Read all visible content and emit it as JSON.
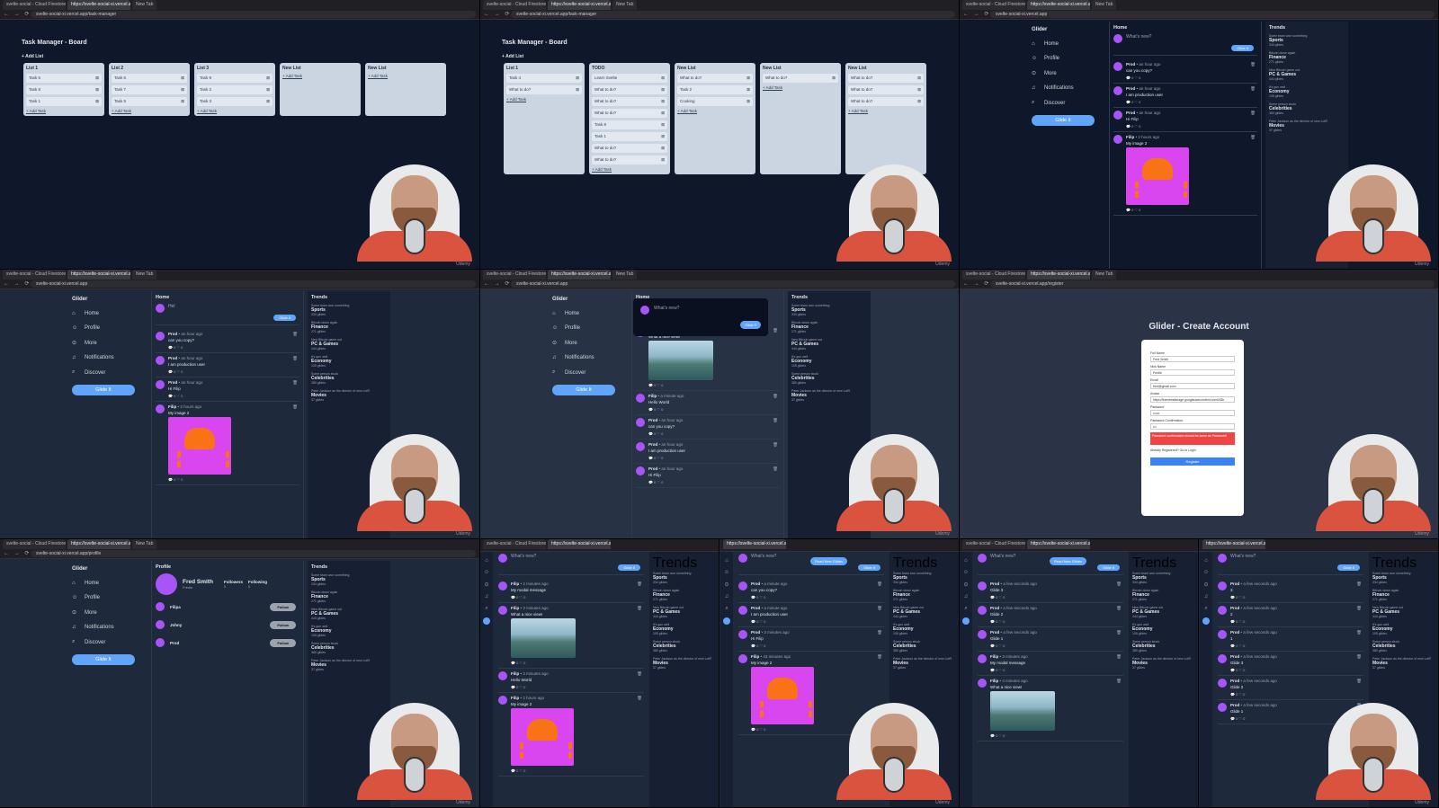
{
  "browser": {
    "tabs": [
      "svelte-social - Cloud Firestore",
      "https://svelte-social-xi.vercel.app",
      "New Tab"
    ],
    "urls": [
      "svelte-social-xi.vercel.app",
      "svelte-social-xi.vercel.app/task-manager",
      "svelte-social-xi.vercel.app/register",
      "svelte-social-xi.vercel.app/profile"
    ],
    "nav_dots": "← → ⟳"
  },
  "webcam_label": "Udemy",
  "board1": {
    "title": "Task Manager - Board",
    "add_list": "+ Add List",
    "lists": [
      {
        "title": "List 1",
        "tasks": [
          "Task 6",
          "Task 8",
          "Task 1"
        ]
      },
      {
        "title": "List 2",
        "tasks": [
          "Task 6",
          "Task 7",
          "Task 5"
        ]
      },
      {
        "title": "List 3",
        "tasks": [
          "Task 9",
          "Task 2",
          "Task 3"
        ]
      },
      {
        "title": "New List",
        "tasks": []
      },
      {
        "title": "New List",
        "tasks": []
      }
    ],
    "add_task": "+ Add Task"
  },
  "board2": {
    "title": "Task Manager - Board",
    "add_list": "+ Add List",
    "lists": [
      {
        "title": "List 1",
        "tasks": [
          "Task 4",
          "What to do?"
        ]
      },
      {
        "title": "TODO",
        "tasks": [
          "Learn Svelte",
          "What to do?",
          "What to do?",
          "What to do?",
          "Task 8",
          "Task 1",
          "What to do?",
          "What to do?"
        ]
      },
      {
        "title": "New List",
        "tasks": [
          "What to do?",
          "Task 2",
          "Cooking"
        ]
      },
      {
        "title": "New List",
        "tasks": [
          "What to do?"
        ]
      },
      {
        "title": "New List",
        "tasks": [
          "What to do?",
          "What to do?",
          "What to do?"
        ]
      }
    ],
    "add_task": "+ Add Task"
  },
  "glider": {
    "logo": "Glider",
    "nav": [
      {
        "label": "Home",
        "icon": "⌂"
      },
      {
        "label": "Profile",
        "icon": "☺"
      },
      {
        "label": "More",
        "icon": "⊙"
      },
      {
        "label": "Notifications",
        "icon": "♫"
      },
      {
        "label": "Discover",
        "icon": "⌕"
      }
    ],
    "glide_button": "Glide It",
    "home_title": "Home",
    "whats_new": "What's new?",
    "compose_text": "Hel",
    "glide_small": "Glide It",
    "posts": [
      {
        "user": "Prod",
        "time": "an hour ago",
        "text": "can you copy?"
      },
      {
        "user": "Prod",
        "time": "an hour ago",
        "text": "I am production user"
      },
      {
        "user": "Prod",
        "time": "an hour ago",
        "text": "Hi Filip"
      },
      {
        "user": "Filip",
        "time": "2 hours ago",
        "text": "My image 2"
      }
    ],
    "post_actions": "💬 0   ♡ 0",
    "trends_title": "Trends",
    "trends": [
      {
        "note": "Some team won something",
        "topic": "Sports",
        "count": "334 glides"
      },
      {
        "note": "Bitcoin down again",
        "topic": "Finance",
        "count": "271 glides"
      },
      {
        "note": "New Bitcoin game out",
        "topic": "PC & Games",
        "count": "444 glides"
      },
      {
        "note": "It's gun well",
        "topic": "Economy",
        "count": "105 glides"
      },
      {
        "note": "Some person stuck",
        "topic": "Celebrities",
        "count": "380 glides"
      },
      {
        "note": "Peter Jackson as the director of new LotR",
        "topic": "Movies",
        "count": "37 glides"
      }
    ]
  },
  "modal_posts": [
    {
      "user": "Filip",
      "time": "",
      "text": "What a nice view!"
    },
    {
      "user": "Filip",
      "time": "a minute ago",
      "text": "Hello World"
    },
    {
      "user": "Prod",
      "time": "an hour ago",
      "text": "can you copy?"
    },
    {
      "user": "Prod",
      "time": "an hour ago",
      "text": "I am production user"
    },
    {
      "user": "Prod",
      "time": "an hour ago",
      "text": "Hi Filip"
    }
  ],
  "register": {
    "title": "Glider - Create Account",
    "fields": [
      {
        "label": "Full Name",
        "value": "Fred Smith"
      },
      {
        "label": "Nick Name",
        "value": "Fredie"
      },
      {
        "label": "Email",
        "value": "fred@gmail.com"
      },
      {
        "label": "Avatar",
        "value": "https://thenewstimage.googleusercontent.com/ADb"
      },
      {
        "label": "Password",
        "value": "••••••"
      },
      {
        "label": "Password Confirmation",
        "value": "•••"
      }
    ],
    "error": "Password confirmation should be same as Password!",
    "login_link": "Already Registered? Go to Login",
    "button": "Register"
  },
  "profile": {
    "title": "Profile",
    "name": "Fred Smith",
    "nick": "Fredie",
    "followers_label": "Followers",
    "following_label": "Following",
    "followers": "0",
    "following": "0",
    "people": [
      "Filipa",
      "Johny",
      "Prod"
    ],
    "follow_button": "Follow"
  },
  "multi": {
    "read_new": "Read New Glides",
    "glide_created": "Glide Created!",
    "w1_posts": [
      {
        "user": "Filip",
        "time": "2 minutes ago",
        "text": "My modal message"
      },
      {
        "user": "Filip",
        "time": "3 minutes ago",
        "text": "What a nice view!"
      },
      {
        "user": "Filip",
        "time": "3 minutes ago",
        "text": "Hello World"
      },
      {
        "user": "Filip",
        "time": "2 hours ago",
        "text": "My image 2"
      }
    ],
    "w2_posts": [
      {
        "user": "Prod",
        "time": "a minute ago",
        "text": "can you copy?"
      },
      {
        "user": "Prod",
        "time": "a minute ago",
        "text": "I am production user"
      },
      {
        "user": "Prod",
        "time": "3 minutes ago",
        "text": "Hi Filip"
      },
      {
        "user": "Filip",
        "time": "43 minutes ago",
        "text": "My image 2"
      }
    ],
    "w3_posts": [
      {
        "user": "Prod",
        "time": "a few seconds ago",
        "text": "Glide 3"
      },
      {
        "user": "Prod",
        "time": "a few seconds ago",
        "text": "Glide 2"
      },
      {
        "user": "Prod",
        "time": "a few seconds ago",
        "text": "Glide 1"
      },
      {
        "user": "Filip",
        "time": "3 minutes ago",
        "text": "My modal message"
      },
      {
        "user": "Filip",
        "time": "4 minutes ago",
        "text": "What a nice view!"
      }
    ],
    "w4_posts": [
      {
        "user": "Prod",
        "time": "a few seconds ago",
        "text": "3"
      },
      {
        "user": "Prod",
        "time": "a few seconds ago",
        "text": "2"
      },
      {
        "user": "Prod",
        "time": "a few seconds ago",
        "text": "1"
      },
      {
        "user": "Prod",
        "time": "a few seconds ago",
        "text": "Glide 3"
      },
      {
        "user": "Prod",
        "time": "a few seconds ago",
        "text": "Glide 2"
      },
      {
        "user": "Prod",
        "time": "a few seconds ago",
        "text": "Glide 1"
      }
    ]
  }
}
